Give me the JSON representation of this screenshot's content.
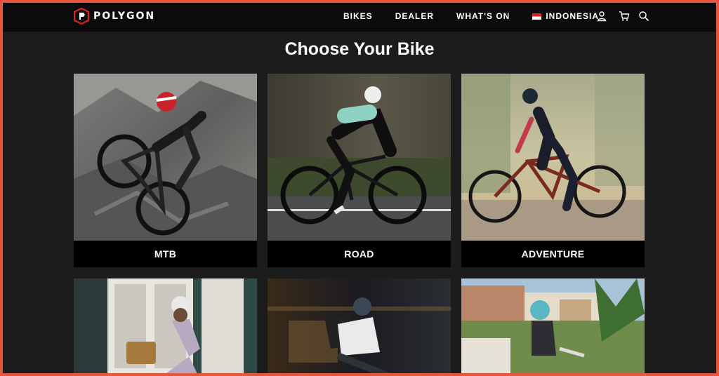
{
  "brand": {
    "name": "POLYGON",
    "logo": "polygon-logo"
  },
  "nav": {
    "items": [
      {
        "label": "BIKES"
      },
      {
        "label": "DEALER"
      },
      {
        "label": "WHAT'S ON"
      }
    ],
    "region": {
      "label": "INDONESIA",
      "flag": "indonesia-flag"
    },
    "icons": [
      "user-icon",
      "cart-icon",
      "search-icon"
    ]
  },
  "main": {
    "title": "Choose Your Bike",
    "categories": [
      {
        "label": "MTB"
      },
      {
        "label": "ROAD"
      },
      {
        "label": "ADVENTURE"
      },
      {
        "label": ""
      },
      {
        "label": ""
      },
      {
        "label": ""
      }
    ]
  },
  "colors": {
    "frame": "#e8553d",
    "background": "#1c1c1c",
    "nav": "#0b0b0b",
    "logo_accent": "#e0201e"
  }
}
